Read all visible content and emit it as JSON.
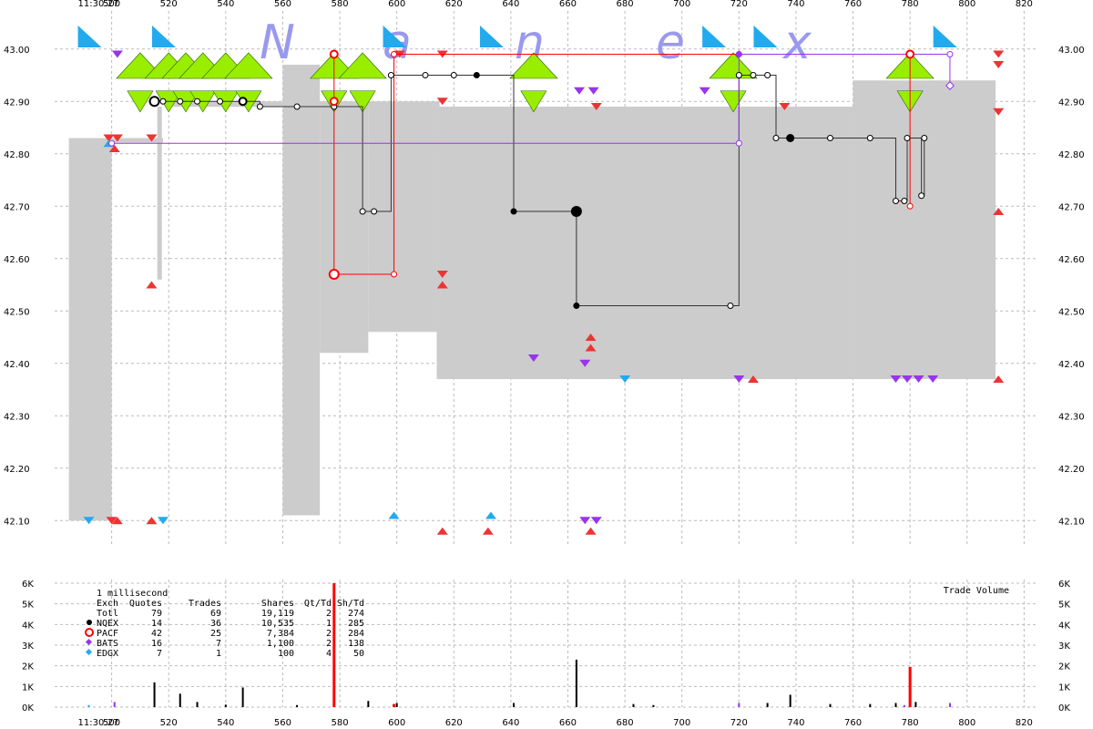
{
  "header": {
    "time_top": "11:30:27",
    "time_bottom": "11:30:27"
  },
  "watermark": [
    "N",
    "a",
    "n",
    "e",
    "x"
  ],
  "colors": {
    "nqex": "#000000",
    "pacf": "#ff0000",
    "bats": "#9933ee",
    "edgx": "#22aaee",
    "nbbo": "#cccccc",
    "trade_marker": "#99ee00",
    "quote_red": "#ee3333"
  },
  "chart_data": {
    "type": "line",
    "x_ticks": [
      "500",
      "520",
      "540",
      "560",
      "580",
      "600",
      "620",
      "640",
      "660",
      "680",
      "700",
      "720",
      "740",
      "760",
      "780",
      "800",
      "820"
    ],
    "xlim": [
      480,
      825
    ],
    "price": {
      "ylim": [
        42.05,
        43.05
      ],
      "y_ticks": [
        "43.00",
        "42.90",
        "42.80",
        "42.70",
        "42.60",
        "42.50",
        "42.40",
        "42.30",
        "42.20",
        "42.10"
      ]
    },
    "volume": {
      "ylim": [
        0,
        6000
      ],
      "y_ticks": [
        "6K",
        "5K",
        "4K",
        "3K",
        "2K",
        "1K",
        "0K"
      ],
      "label": "Trade Volume"
    },
    "nbbo_band": [
      [
        485,
        42.83,
        42.1
      ],
      [
        500,
        42.83,
        42.1
      ],
      [
        500,
        42.82,
        42.82
      ],
      [
        518,
        42.82,
        42.82
      ],
      [
        560,
        42.88,
        42.82
      ],
      [
        560,
        42.97,
        42.11
      ],
      [
        573,
        42.97,
        42.11
      ],
      [
        573,
        42.9,
        42.42
      ],
      [
        590,
        42.9,
        42.42
      ],
      [
        590,
        42.89,
        42.46
      ],
      [
        614,
        42.89,
        42.46
      ],
      [
        614,
        42.89,
        42.37
      ],
      [
        760,
        42.89,
        42.37
      ],
      [
        760,
        42.94,
        42.37
      ],
      [
        810,
        42.94,
        42.37
      ]
    ],
    "series": [
      {
        "name": "NQEX",
        "color": "#000000",
        "points": [
          [
            515,
            42.9
          ],
          [
            518,
            42.9
          ],
          [
            524,
            42.9
          ],
          [
            530,
            42.9
          ],
          [
            538,
            42.9
          ],
          [
            546,
            42.9
          ],
          [
            552,
            42.89
          ],
          [
            565,
            42.89
          ],
          [
            578,
            42.89
          ],
          [
            588,
            42.69
          ],
          [
            592,
            42.69
          ],
          [
            598,
            42.95
          ],
          [
            610,
            42.95
          ],
          [
            620,
            42.95
          ],
          [
            628,
            42.95
          ],
          [
            641,
            42.69
          ],
          [
            663,
            42.69
          ],
          [
            663,
            42.51
          ],
          [
            717,
            42.51
          ],
          [
            720,
            42.95
          ],
          [
            725,
            42.95
          ],
          [
            730,
            42.95
          ],
          [
            733,
            42.83
          ],
          [
            738,
            42.83
          ],
          [
            752,
            42.83
          ],
          [
            766,
            42.83
          ],
          [
            775,
            42.71
          ],
          [
            778,
            42.71
          ],
          [
            779,
            42.83
          ],
          [
            784,
            42.72
          ],
          [
            785,
            42.83
          ]
        ],
        "volumes": [
          [
            515,
            1200
          ],
          [
            524,
            650
          ],
          [
            530,
            250
          ],
          [
            540,
            120
          ],
          [
            546,
            950
          ],
          [
            565,
            100
          ],
          [
            590,
            300
          ],
          [
            600,
            200
          ],
          [
            641,
            200
          ],
          [
            663,
            2300
          ],
          [
            683,
            150
          ],
          [
            690,
            100
          ],
          [
            730,
            200
          ],
          [
            738,
            600
          ],
          [
            752,
            150
          ],
          [
            766,
            150
          ],
          [
            775,
            200
          ],
          [
            782,
            250
          ]
        ]
      },
      {
        "name": "PACF",
        "color": "#ff0000",
        "points": [
          [
            578,
            42.99
          ],
          [
            578,
            42.57
          ],
          [
            599,
            42.57
          ],
          [
            599,
            42.99
          ],
          [
            780,
            42.99
          ],
          [
            780,
            42.7
          ]
        ],
        "volumes": [
          [
            578,
            6000
          ],
          [
            599,
            150
          ],
          [
            780,
            1950
          ]
        ]
      },
      {
        "name": "BATS",
        "color": "#9933ee",
        "points": [
          [
            500,
            42.82
          ],
          [
            720,
            42.82
          ],
          [
            720,
            42.99
          ],
          [
            794,
            42.99
          ],
          [
            794,
            42.93
          ]
        ],
        "volumes": [
          [
            501,
            250
          ],
          [
            720,
            200
          ],
          [
            778,
            100
          ],
          [
            794,
            200
          ]
        ]
      },
      {
        "name": "EDGX",
        "color": "#22aaee",
        "points": [],
        "volumes": [
          [
            492,
            100
          ]
        ]
      }
    ],
    "summary": {
      "interval": "1 millisecond",
      "headers": [
        "Exch",
        "Quotes",
        "Trades",
        "Shares",
        "Qt/Td",
        "Sh/Td"
      ],
      "rows": [
        {
          "exch": "Totl",
          "quotes": "79",
          "trades": "69",
          "shares": "19,119",
          "qt_td": "2",
          "sh_td": "274"
        },
        {
          "exch": "NQEX",
          "quotes": "14",
          "trades": "36",
          "shares": "10,535",
          "qt_td": "1",
          "sh_td": "285"
        },
        {
          "exch": "PACF",
          "quotes": "42",
          "trades": "25",
          "shares": "7,384",
          "qt_td": "2",
          "sh_td": "284"
        },
        {
          "exch": "BATS",
          "quotes": "16",
          "trades": "7",
          "shares": "1,100",
          "qt_td": "2",
          "sh_td": "138"
        },
        {
          "exch": "EDGX",
          "quotes": "7",
          "trades": "1",
          "shares": "100",
          "qt_td": "4",
          "sh_td": "50"
        }
      ]
    },
    "trade_markers": [
      510,
      520,
      526,
      532,
      540,
      548,
      578,
      588,
      648,
      718,
      780
    ],
    "quote_markers": [
      {
        "x": 502,
        "y": 42.99,
        "color": "#9933ee",
        "dir": "down"
      },
      {
        "x": 601,
        "y": 42.99,
        "color": "#ee3333",
        "dir": "down"
      },
      {
        "x": 616,
        "y": 42.99,
        "color": "#ee3333",
        "dir": "down"
      },
      {
        "x": 616,
        "y": 42.9,
        "color": "#ee3333",
        "dir": "down"
      },
      {
        "x": 670,
        "y": 42.89,
        "color": "#ee3333",
        "dir": "down"
      },
      {
        "x": 664,
        "y": 42.92,
        "color": "#9933ee",
        "dir": "down"
      },
      {
        "x": 669,
        "y": 42.92,
        "color": "#9933ee",
        "dir": "down"
      },
      {
        "x": 708,
        "y": 42.92,
        "color": "#9933ee",
        "dir": "down"
      },
      {
        "x": 736,
        "y": 42.89,
        "color": "#ee3333",
        "dir": "down"
      },
      {
        "x": 811,
        "y": 42.99,
        "color": "#ee3333",
        "dir": "down"
      },
      {
        "x": 811,
        "y": 42.97,
        "color": "#ee3333",
        "dir": "down"
      },
      {
        "x": 811,
        "y": 42.88,
        "color": "#ee3333",
        "dir": "down"
      },
      {
        "x": 499,
        "y": 42.83,
        "color": "#ee3333",
        "dir": "down"
      },
      {
        "x": 502,
        "y": 42.83,
        "color": "#ee3333",
        "dir": "down"
      },
      {
        "x": 514,
        "y": 42.83,
        "color": "#ee3333",
        "dir": "down"
      },
      {
        "x": 499,
        "y": 42.82,
        "color": "#22aaee",
        "dir": "up"
      },
      {
        "x": 501,
        "y": 42.81,
        "color": "#ee3333",
        "dir": "up"
      },
      {
        "x": 514,
        "y": 42.55,
        "color": "#ee3333",
        "dir": "up"
      },
      {
        "x": 616,
        "y": 42.57,
        "color": "#ee3333",
        "dir": "down"
      },
      {
        "x": 616,
        "y": 42.55,
        "color": "#ee3333",
        "dir": "up"
      },
      {
        "x": 668,
        "y": 42.45,
        "color": "#ee3333",
        "dir": "up"
      },
      {
        "x": 668,
        "y": 42.43,
        "color": "#ee3333",
        "dir": "up"
      },
      {
        "x": 648,
        "y": 42.41,
        "color": "#9933ee",
        "dir": "down"
      },
      {
        "x": 666,
        "y": 42.4,
        "color": "#9933ee",
        "dir": "down"
      },
      {
        "x": 680,
        "y": 42.37,
        "color": "#22aaee",
        "dir": "down"
      },
      {
        "x": 720,
        "y": 42.37,
        "color": "#9933ee",
        "dir": "down"
      },
      {
        "x": 725,
        "y": 42.37,
        "color": "#ee3333",
        "dir": "up"
      },
      {
        "x": 775,
        "y": 42.37,
        "color": "#9933ee",
        "dir": "down"
      },
      {
        "x": 779,
        "y": 42.37,
        "color": "#9933ee",
        "dir": "down"
      },
      {
        "x": 783,
        "y": 42.37,
        "color": "#9933ee",
        "dir": "down"
      },
      {
        "x": 788,
        "y": 42.37,
        "color": "#9933ee",
        "dir": "down"
      },
      {
        "x": 811,
        "y": 42.37,
        "color": "#ee3333",
        "dir": "up"
      },
      {
        "x": 811,
        "y": 42.69,
        "color": "#ee3333",
        "dir": "up"
      },
      {
        "x": 492,
        "y": 42.1,
        "color": "#22aaee",
        "dir": "down"
      },
      {
        "x": 500,
        "y": 42.1,
        "color": "#ee3333",
        "dir": "down"
      },
      {
        "x": 502,
        "y": 42.1,
        "color": "#ee3333",
        "dir": "up"
      },
      {
        "x": 514,
        "y": 42.1,
        "color": "#ee3333",
        "dir": "up"
      },
      {
        "x": 518,
        "y": 42.1,
        "color": "#22aaee",
        "dir": "down"
      },
      {
        "x": 599,
        "y": 42.11,
        "color": "#22aaee",
        "dir": "up"
      },
      {
        "x": 616,
        "y": 42.08,
        "color": "#ee3333",
        "dir": "up"
      },
      {
        "x": 632,
        "y": 42.08,
        "color": "#ee3333",
        "dir": "up"
      },
      {
        "x": 633,
        "y": 42.11,
        "color": "#22aaee",
        "dir": "up"
      },
      {
        "x": 666,
        "y": 42.1,
        "color": "#9933ee",
        "dir": "down"
      },
      {
        "x": 670,
        "y": 42.1,
        "color": "#9933ee",
        "dir": "down"
      },
      {
        "x": 668,
        "y": 42.08,
        "color": "#ee3333",
        "dir": "up"
      }
    ],
    "ask_flags": [
      492,
      518,
      599,
      633,
      711,
      729,
      792
    ]
  }
}
